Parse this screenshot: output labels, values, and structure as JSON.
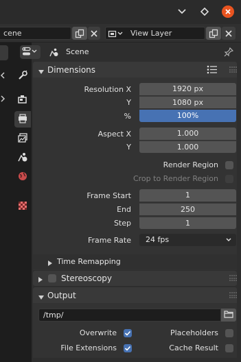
{
  "header": {
    "scene_field": "cene",
    "view_layer_field": "View Layer"
  },
  "props_header": {
    "scene_label": "Scene"
  },
  "dimensions": {
    "title": "Dimensions",
    "resolution_x_label": "Resolution X",
    "resolution_x": "1920 px",
    "resolution_y_label": "Y",
    "resolution_y": "1080 px",
    "percent_label": "%",
    "percent": "100%",
    "percent_value": 1.0,
    "aspect_x_label": "Aspect X",
    "aspect_x": "1.000",
    "aspect_y_label": "Y",
    "aspect_y": "1.000",
    "render_region_label": "Render Region",
    "crop_label": "Crop to Render Region",
    "frame_start_label": "Frame Start",
    "frame_start": "1",
    "end_label": "End",
    "end": "250",
    "step_label": "Step",
    "step": "1",
    "frame_rate_label": "Frame Rate",
    "frame_rate": "24 fps",
    "time_remapping_label": "Time Remapping"
  },
  "stereoscopy": {
    "title": "Stereoscopy"
  },
  "output": {
    "title": "Output",
    "path": "/tmp/",
    "overwrite_label": "Overwrite",
    "placeholders_label": "Placeholders",
    "file_extensions_label": "File Extensions",
    "cache_result_label": "Cache Result"
  },
  "colors": {
    "accent": "#4772b3",
    "close": "#e95420"
  }
}
